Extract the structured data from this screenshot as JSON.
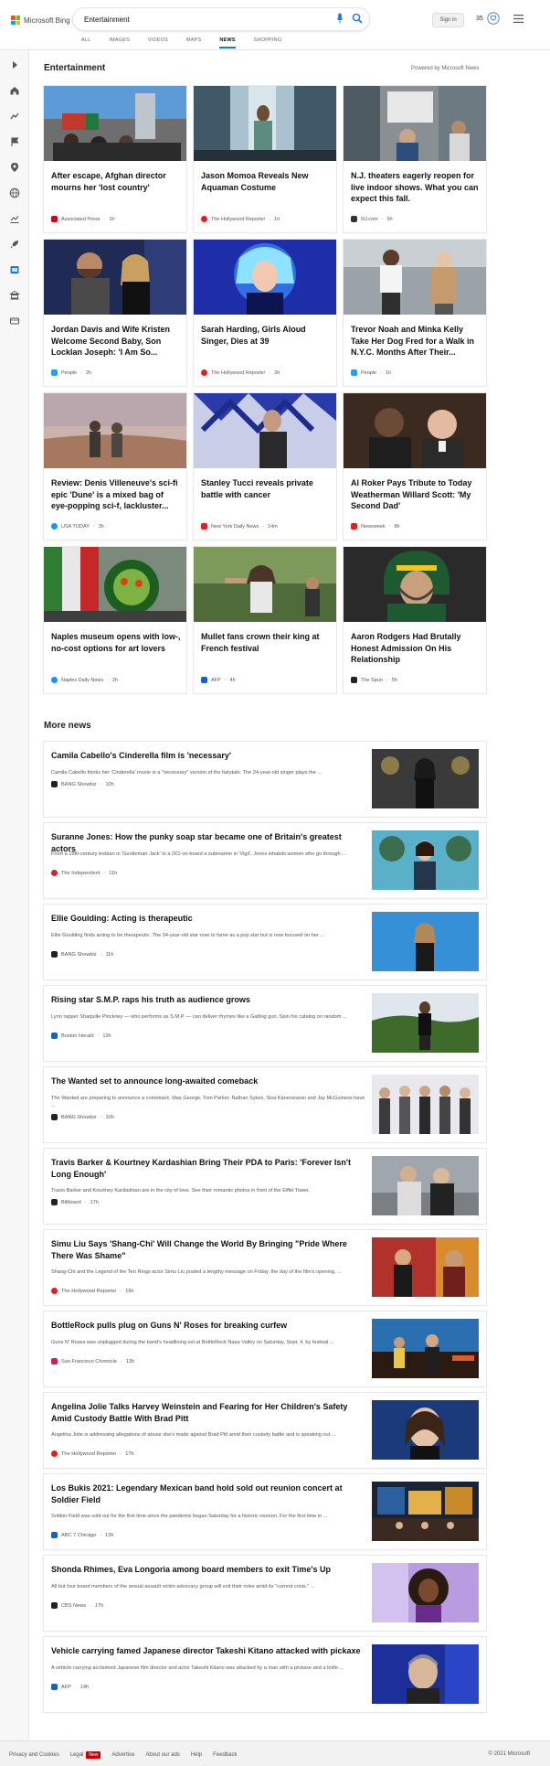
{
  "header": {
    "logo_text": "Microsoft Bing",
    "search_value": "Entertainment",
    "signin": "Sign in",
    "rewards_count": "35",
    "tabs": [
      "ALL",
      "IMAGES",
      "VIDEOS",
      "MAPS",
      "NEWS",
      "SHOPPING"
    ],
    "active_tab": "NEWS"
  },
  "main": {
    "section_title": "Entertainment",
    "powered_by": "Powered by Microsoft News",
    "cards": [
      {
        "title": "After escape, Afghan director mourns her 'lost country'",
        "source": "Associated Press",
        "age": "1h",
        "src_color": "#d0021b"
      },
      {
        "title": "Jason Momoa Reveals New Aquaman Costume",
        "source": "The Hollywood Reporter",
        "age": "1h",
        "src_color": "#e02020"
      },
      {
        "title": "N.J. theaters eagerly reopen for live indoor shows. What you can expect this fall.",
        "source": "NJ.com",
        "age": "5h",
        "src_color": "#333333"
      },
      {
        "title": "Jordan Davis and Wife Kristen Welcome Second Baby, Son Locklan Joseph: 'I Am So...",
        "source": "People",
        "age": "2h",
        "src_color": "#2a9df4"
      },
      {
        "title": "Sarah Harding, Girls Aloud Singer, Dies at 39",
        "source": "The Hollywood Reporter",
        "age": "3h",
        "src_color": "#e02020"
      },
      {
        "title": "Trevor Noah and Minka Kelly Take Her Dog Fred for a Walk in N.Y.C. Months After Their...",
        "source": "People",
        "age": "1h",
        "src_color": "#2a9df4"
      },
      {
        "title": "Review: Denis Villeneuve's sci-fi epic 'Dune' is a mixed bag of eye-popping sci-f, lackluster...",
        "source": "USA TODAY",
        "age": "3h",
        "src_color": "#1e90ff"
      },
      {
        "title": "Stanley Tucci reveals private battle with cancer",
        "source": "New York Daily News",
        "age": "14m",
        "src_color": "#e02020"
      },
      {
        "title": "Al Roker Pays Tribute to Today Weatherman Willard Scott: 'My Second Dad'",
        "source": "Newsweek",
        "age": "8h",
        "src_color": "#e02020"
      },
      {
        "title": "Naples museum opens with low-, no-cost options for art lovers",
        "source": "Naples Daily News",
        "age": "2h",
        "src_color": "#1e90ff"
      },
      {
        "title": "Mullet fans crown their king at French festival",
        "source": "AFP",
        "age": "4h",
        "src_color": "#1565c0"
      },
      {
        "title": "Aaron Rodgers Had Brutally Honest Admission On His Relationship",
        "source": "The Spun",
        "age": "5h",
        "src_color": "#222222"
      }
    ],
    "more_title": "More news",
    "more": [
      {
        "title": "Camila Cabello's Cinderella film is 'necessary'",
        "snippet": "Camila Cabello thinks her 'Cinderella' movie is a \"necessary\" version of the fairytale. The 24-year-old singer plays the ...",
        "source": "BANG Showbiz",
        "age": "10h",
        "src_color": "#222222"
      },
      {
        "title": "Suranne Jones: How the punky soap star became one of Britain's greatest actors",
        "snippet": "From a 19th-century lesbian in 'Gentleman Jack' to a DCI on-board a submarine in 'Vigil', Jones inhabits women who go through ...",
        "source": "The Independent",
        "age": "11h",
        "src_color": "#e02020"
      },
      {
        "title": "Ellie Goulding: Acting is therapeutic",
        "snippet": "Ellie Goulding finds acting to be therapeutic. The 34-year-old star rose to fame as a pop star but is now focused on her ...",
        "source": "BANG Showbiz",
        "age": "11h",
        "src_color": "#222222"
      },
      {
        "title": "Rising star S.M.P. raps his truth as audience grows",
        "snippet": "Lynn rapper Shaquille Pinckney — who performs as S.M.P. — can deliver rhymes like a Gatling gun. Spin his catalog on random ...",
        "source": "Boston Herald",
        "age": "12h",
        "src_color": "#1565c0"
      },
      {
        "title": "The Wanted set to announce long-awaited comeback",
        "snippet": "The Wanted are preparing to announce a comeback. Max George, Tom Parker, Nathan Sykes, Siva Kaneswaran and Jay McGuiness have ...",
        "source": "BANG Showbiz",
        "age": "10h",
        "src_color": "#222222"
      },
      {
        "title": "Travis Barker & Kourtney Kardashian Bring Their PDA to Paris: 'Forever Isn't Long Enough'",
        "snippet": "Travis Barker and Kourtney Kardashian are in the city of love. See their romantic photos in front of the Eiffel Tower.",
        "source": "Billboard",
        "age": "17h",
        "src_color": "#222222"
      },
      {
        "title": "Simu Liu Says 'Shang-Chi' Will Change the World By Bringing \"Pride Where There Was Shame\"",
        "snippet": "Shang-Chi and the Legend of the Ten Rings actor Simu Liu posted a lengthy message on Friday, the day of the film's opening, ...",
        "source": "The Hollywood Reporter",
        "age": "16h",
        "src_color": "#e02020"
      },
      {
        "title": "BottleRock pulls plug on Guns N' Roses for breaking curfew",
        "snippet": "Guns N' Roses was unplugged during the band's headlining set at BottleRock Napa Valley on Saturday, Sept. 4, by festival ...",
        "source": "San Francisco Chronicle",
        "age": "13h",
        "src_color": "#d81b60"
      },
      {
        "title": "Angelina Jolie Talks Harvey Weinstein and Fearing for Her Children's Safety Amid Custody Battle With Brad Pitt",
        "snippet": "Angelina Jolie is addressing allegations of abuse she's made against Brad Pitt amid their custody battle and is speaking out ...",
        "source": "The Hollywood Reporter",
        "age": "17h",
        "src_color": "#e02020"
      },
      {
        "title": "Los Bukis 2021: Legendary Mexican band hold sold out reunion concert at Soldier Field",
        "snippet": "Soldier Field was sold out for the first time since the pandemic began Saturday for a historic reunion. For the first time in ...",
        "source": "ABC 7 Chicago",
        "age": "13h",
        "src_color": "#1565c0"
      },
      {
        "title": "Shonda Rhimes, Eva Longoria among board members to exit Time's Up",
        "snippet": "All but four board members of the sexual assault victim advocacy group will exit their roles amid its \"current crisis.\" ...",
        "source": "CBS News",
        "age": "17h",
        "src_color": "#222222"
      },
      {
        "title": "Vehicle carrying famed Japanese director Takeshi Kitano attacked with pickaxe",
        "snippet": "A vehicle carrying acclaimed Japanese film director and actor Takeshi Kitano was attacked by a man with a pickaxe and a knife ...",
        "source": "AFP",
        "age": "14h",
        "src_color": "#1565c0"
      }
    ]
  },
  "footer": {
    "links": [
      "Privacy and Cookies",
      "Legal",
      "Advertise",
      "About our ads",
      "Help",
      "Feedback"
    ],
    "new_badge": "New",
    "copyright": "© 2021 Microsoft"
  }
}
